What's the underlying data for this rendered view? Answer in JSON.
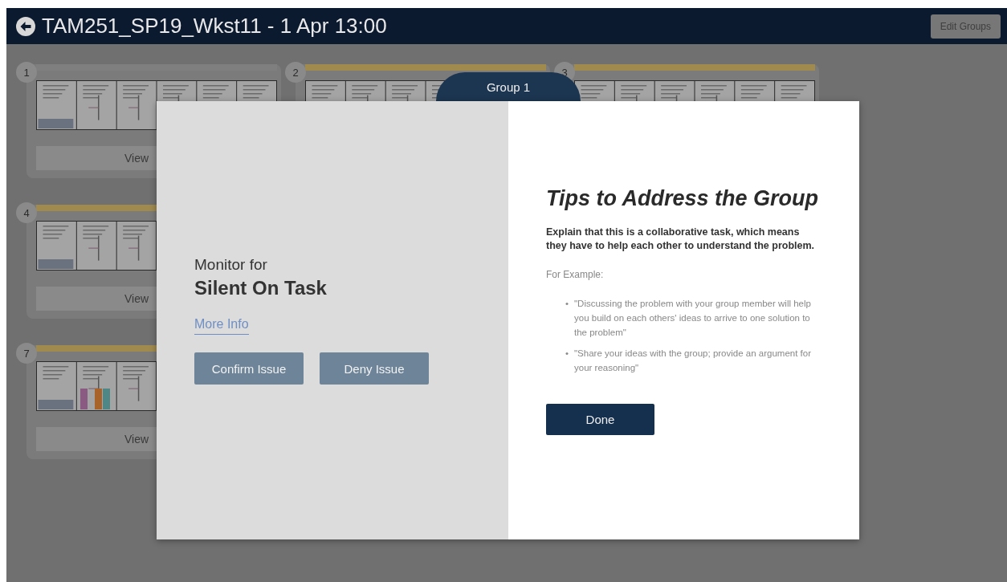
{
  "header": {
    "title": "TAM251_SP19_Wkst11 - 1 Apr 13:00",
    "edit_button": "Edit Groups"
  },
  "card_rows": [
    [
      {
        "number": "1",
        "color": "#7f7f7f",
        "button": "View"
      },
      {
        "number": "2",
        "color": "#a08a4e"
      },
      {
        "number": "3",
        "color": "#a08a4e"
      }
    ],
    [
      {
        "number": "4",
        "color": "#a08a4e",
        "button": "View"
      }
    ],
    [
      {
        "number": "7",
        "color": "#a08a4e",
        "button": "View",
        "tags": [
          {
            "color": "#8a5a82"
          },
          {
            "color": "#a8632a"
          },
          {
            "color": "#4f8686"
          }
        ]
      }
    ]
  ],
  "modal": {
    "tab": "Group 1",
    "left": {
      "intro": "Monitor for",
      "issue": "Silent On Task",
      "link": "More Info",
      "buttons": [
        "Confirm Issue",
        "Deny Issue"
      ]
    },
    "right": {
      "title": "Tips to Address the Group",
      "lead": "Explain that this is a collaborative task, which means they have to help each other to understand the problem.",
      "example_label": "For Example:",
      "examples": [
        {
          "bullet": "•",
          "text": "\"Discussing the problem with your group member will help you build on each others' ideas to arrive to one solution to the problem\""
        },
        {
          "bullet": "•",
          "text": "\"Share your ideas with the group; provide an argument for your reasoning\""
        }
      ],
      "done": "Done"
    }
  }
}
